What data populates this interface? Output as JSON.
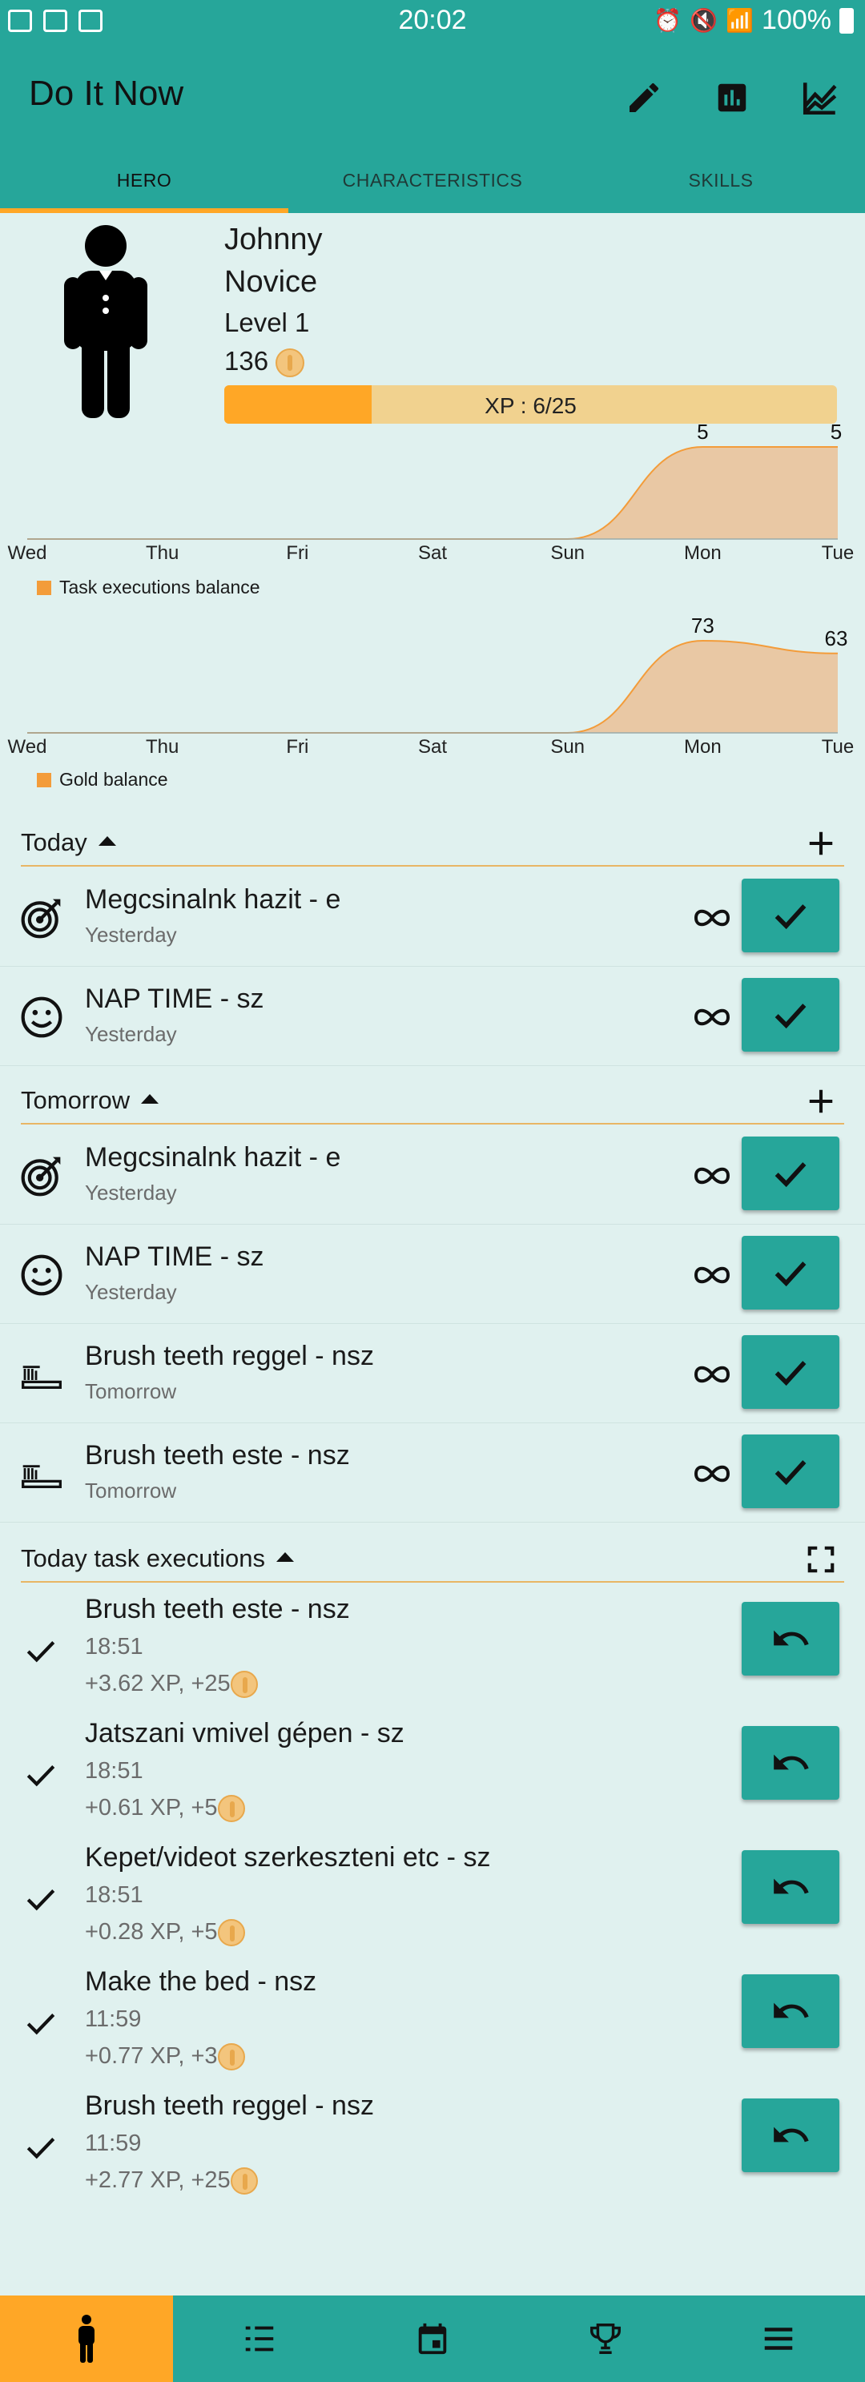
{
  "status_bar": {
    "time": "20:02",
    "battery": "100%"
  },
  "app": {
    "title": "Do It Now"
  },
  "toolbar": {
    "icons": [
      "edit-icon",
      "bar-chart-icon",
      "line-chart-icon"
    ]
  },
  "tabs": [
    {
      "label": "HERO",
      "active": true
    },
    {
      "label": "CHARACTERISTICS",
      "active": false
    },
    {
      "label": "SKILLS",
      "active": false
    }
  ],
  "hero": {
    "name": "Johnny",
    "rank": "Novice",
    "level": "Level 1",
    "gold": "136",
    "xp_label": "XP : 6/25",
    "xp_fraction": 0.24
  },
  "chart_data": [
    {
      "type": "area",
      "x": [
        "Wed",
        "Thu",
        "Fri",
        "Sat",
        "Sun",
        "Mon",
        "Tue"
      ],
      "series": [
        {
          "name": "Task executions balance",
          "values": [
            0,
            0,
            0,
            0,
            0,
            5,
            5
          ]
        }
      ],
      "data_labels": [
        "5",
        "5"
      ],
      "color": "#f39c3a"
    },
    {
      "type": "area",
      "x": [
        "Wed",
        "Thu",
        "Fri",
        "Sat",
        "Sun",
        "Mon",
        "Tue"
      ],
      "series": [
        {
          "name": "Gold balance",
          "values": [
            0,
            0,
            0,
            0,
            0,
            73,
            63
          ]
        }
      ],
      "data_labels": [
        "73",
        "63"
      ],
      "color": "#f39c3a"
    }
  ],
  "sections": {
    "today": {
      "label": "Today",
      "tasks": [
        {
          "name": "Megcsinalnk hazit - e",
          "sub": "Yesterday",
          "icon": "target-icon"
        },
        {
          "name": "NAP TIME - sz",
          "sub": "Yesterday",
          "icon": "smiley-icon"
        }
      ]
    },
    "tomorrow": {
      "label": "Tomorrow",
      "tasks": [
        {
          "name": "Megcsinalnk hazit - e",
          "sub": "Yesterday",
          "icon": "target-icon"
        },
        {
          "name": "NAP TIME - sz",
          "sub": "Yesterday",
          "icon": "smiley-icon"
        },
        {
          "name": "Brush teeth reggel - nsz",
          "sub": "Tomorrow",
          "icon": "toothbrush-icon"
        },
        {
          "name": "Brush teeth este - nsz",
          "sub": "Tomorrow",
          "icon": "toothbrush-icon"
        }
      ]
    },
    "executions": {
      "label": "Today task executions",
      "items": [
        {
          "name": "Brush teeth este - nsz",
          "time": "18:51",
          "gain": "+3.62 XP, +25"
        },
        {
          "name": "Jatszani vmivel gépen - sz",
          "time": "18:51",
          "gain": "+0.61 XP, +5"
        },
        {
          "name": "Kepet/videot szerkeszteni etc - sz",
          "time": "18:51",
          "gain": "+0.28 XP, +5"
        },
        {
          "name": "Make the bed - nsz",
          "time": "11:59",
          "gain": "+0.77 XP, +3"
        },
        {
          "name": "Brush teeth reggel - nsz",
          "time": "11:59",
          "gain": "+2.77 XP, +25"
        }
      ]
    }
  },
  "bottom_nav": [
    "hero-icon",
    "tasks-list-icon",
    "calendar-icon",
    "trophy-icon",
    "menu-icon"
  ],
  "colors": {
    "primary": "#26a69a",
    "accent": "#ffa726",
    "background": "#e0f1ef"
  }
}
